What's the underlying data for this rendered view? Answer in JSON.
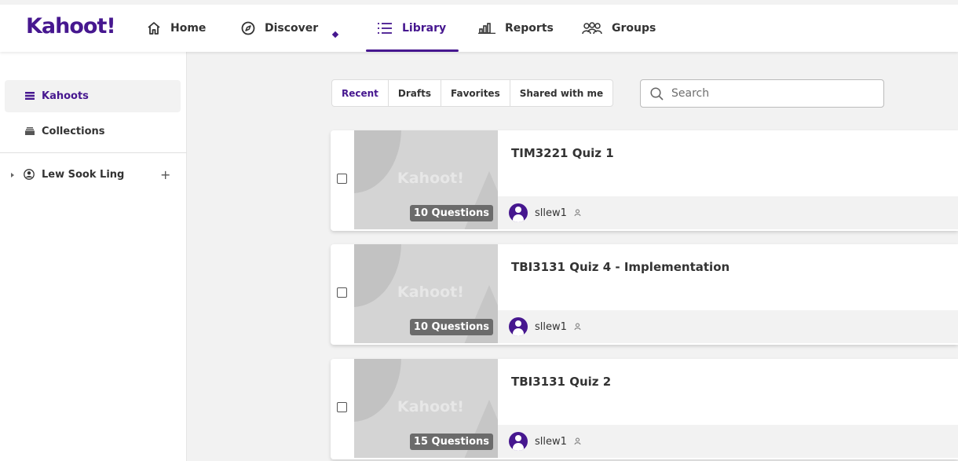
{
  "brand": {
    "logo_text": "Kahoot!",
    "accent": "#46178f"
  },
  "nav": {
    "home": "Home",
    "discover": "Discover",
    "library": "Library",
    "reports": "Reports",
    "groups": "Groups"
  },
  "sidebar": {
    "items": [
      {
        "label": "Kahoots",
        "icon": "kahoots-icon",
        "active": true
      },
      {
        "label": "Collections",
        "icon": "collections-icon",
        "active": false
      }
    ],
    "user": {
      "name": "Lew Sook Ling",
      "add": "+"
    }
  },
  "filters": {
    "tabs": [
      "Recent",
      "Drafts",
      "Favorites",
      "Shared with me"
    ],
    "active": "Recent"
  },
  "search": {
    "placeholder": "Search",
    "value": ""
  },
  "kahoots": [
    {
      "title": "TIM3221 Quiz 1",
      "questions": "10 Questions",
      "owner": "sllew1",
      "thumb_watermark": "Kahoot!"
    },
    {
      "title": "TBI3131 Quiz 4 - Implementation",
      "questions": "10 Questions",
      "owner": "sllew1",
      "thumb_watermark": "Kahoot!"
    },
    {
      "title": "TBI3131 Quiz 2",
      "questions": "15 Questions",
      "owner": "sllew1",
      "thumb_watermark": "Kahoot!"
    }
  ]
}
